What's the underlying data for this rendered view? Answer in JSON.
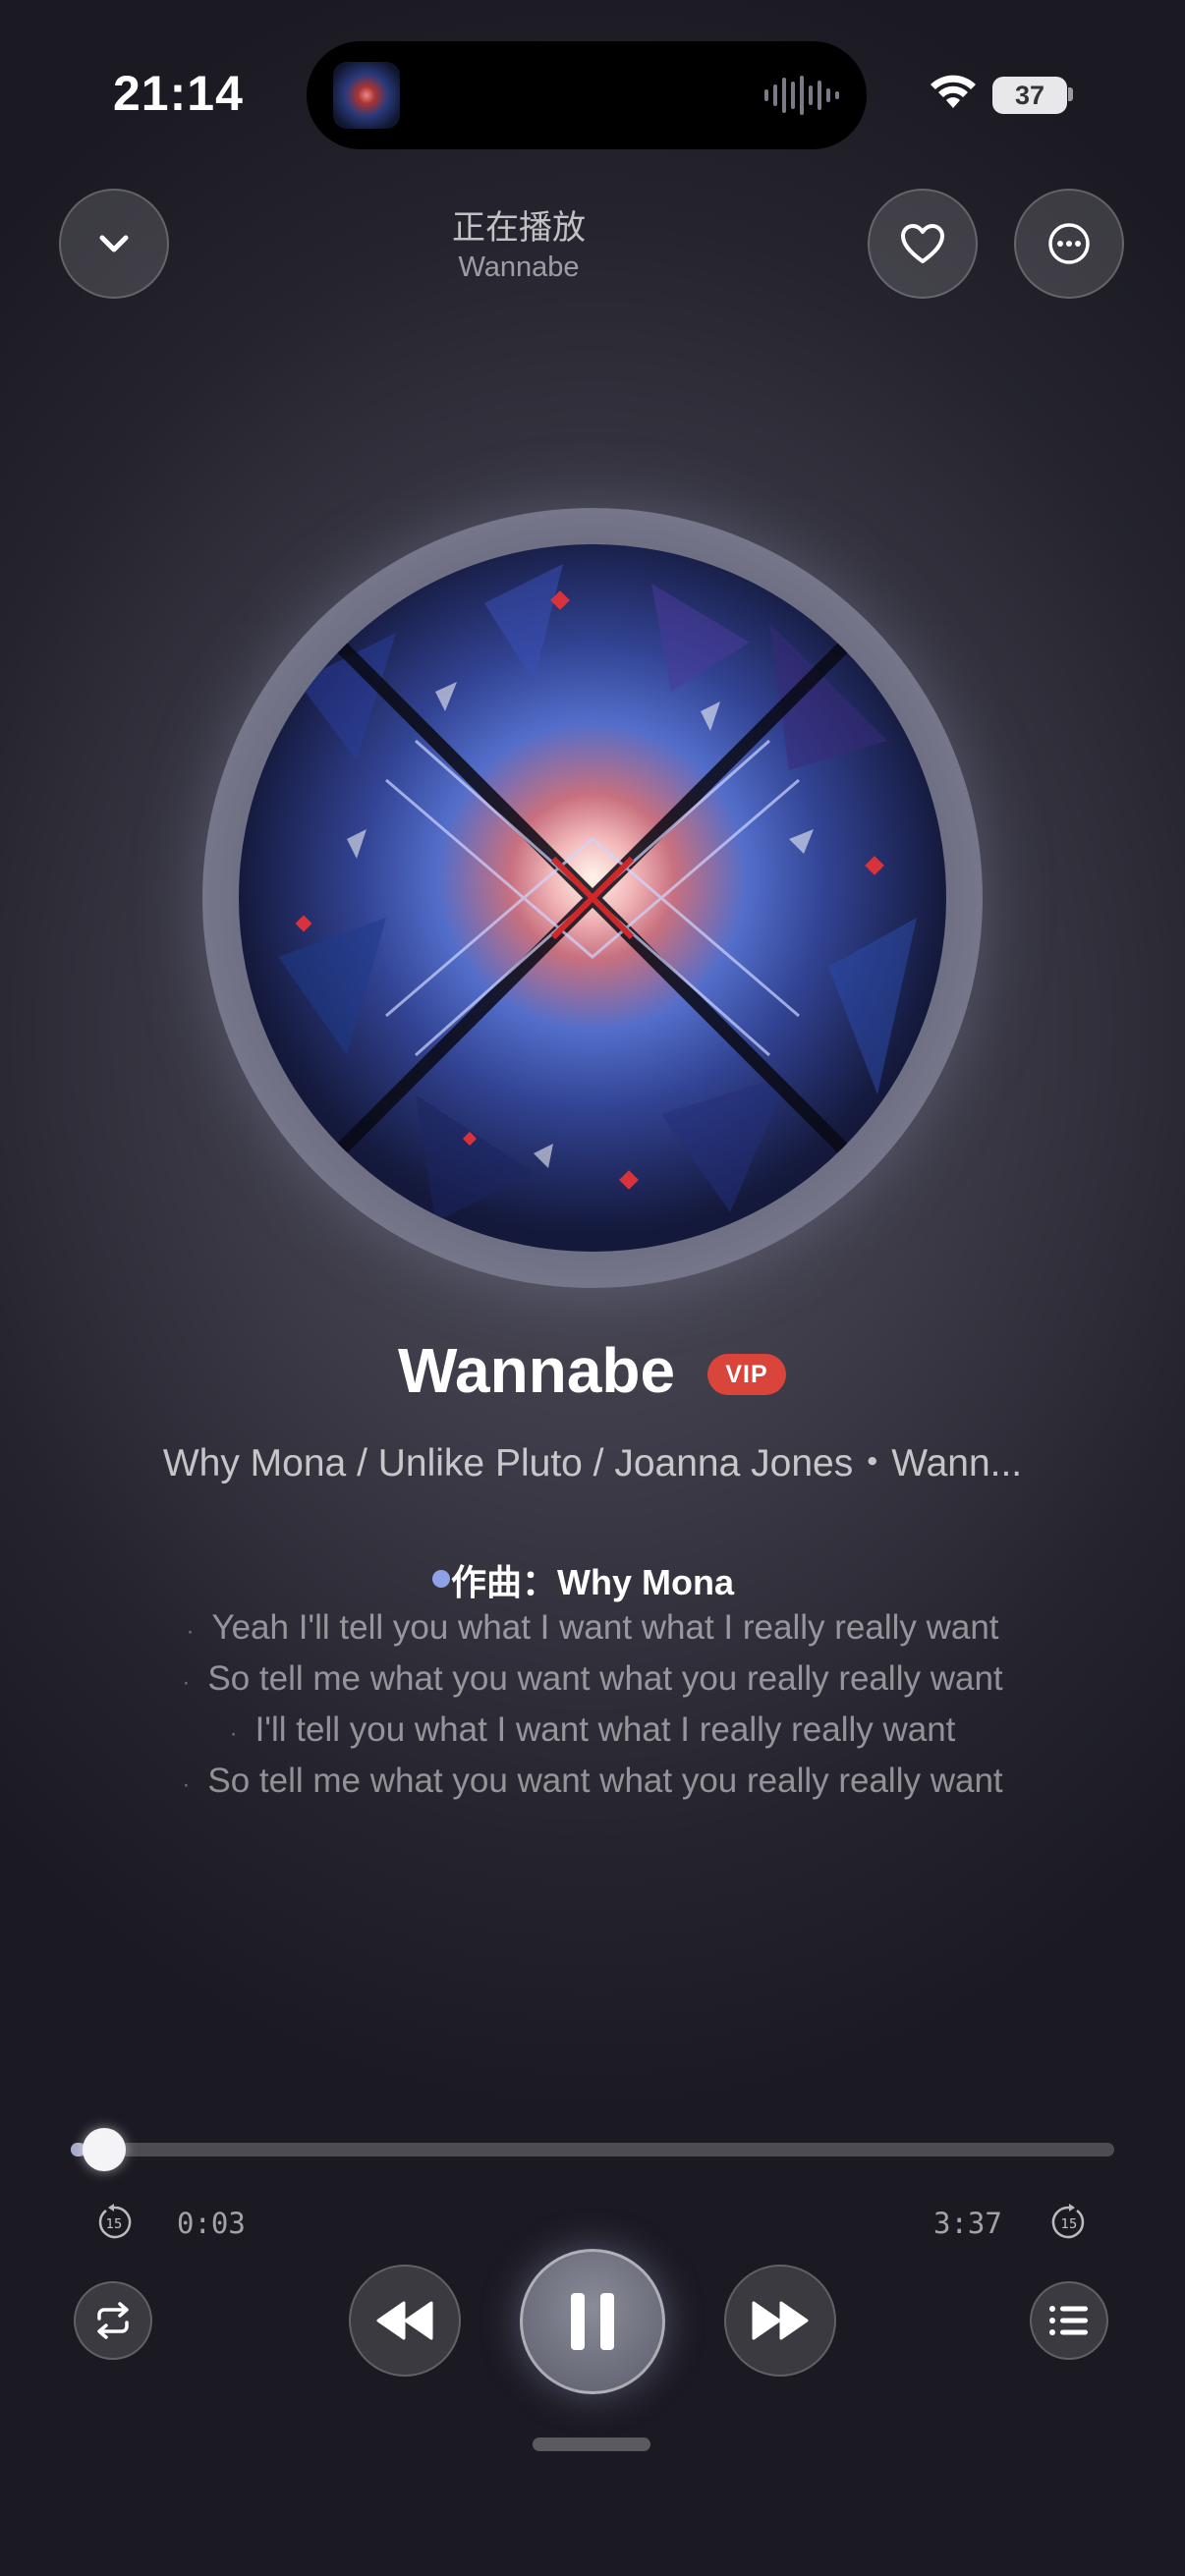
{
  "status_bar": {
    "time": "21:14",
    "battery": "37"
  },
  "header": {
    "title": "正在播放",
    "subtitle": "Wannabe"
  },
  "song": {
    "title": "Wannabe",
    "badge": "VIP",
    "artists": "Why Mona / Unlike Pluto / Joanna Jones・Wann..."
  },
  "lyrics": {
    "credit": "作曲：Why Mona",
    "lines": [
      "Yeah I'll tell you what I want what I really really want",
      "So tell me what you want what you really really want",
      "I'll tell you what I want what I really really want",
      "So tell me what you want what you really really want"
    ]
  },
  "player": {
    "elapsed": "0:03",
    "duration": "3:37",
    "progress": 0.014,
    "skip_back_seconds": "15",
    "skip_forward_seconds": "15"
  },
  "icons": {
    "collapse": "chevron-down-icon",
    "favorite": "heart-icon",
    "more": "more-options-icon",
    "repeat": "repeat-icon",
    "rewind": "rewind-icon",
    "pause": "pause-icon",
    "forward": "fast-forward-icon",
    "queue": "queue-list-icon"
  },
  "colors": {
    "vip": "#d9453b",
    "lyric_dot": "#8fa2e6"
  }
}
